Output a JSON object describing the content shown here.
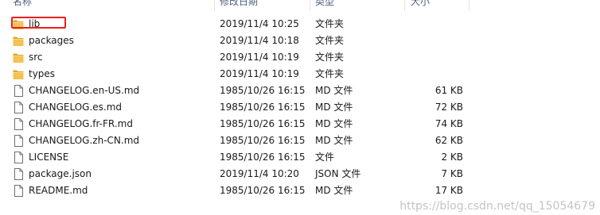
{
  "columns": {
    "name": "名称",
    "date": "修改日期",
    "type": "类型",
    "size": "大小"
  },
  "rows": [
    {
      "name": "lib",
      "date": "2019/11/4 10:25",
      "type": "文件夹",
      "size": "",
      "icon": "folder-icon"
    },
    {
      "name": "packages",
      "date": "2019/11/4 10:18",
      "type": "文件夹",
      "size": "",
      "icon": "folder-icon"
    },
    {
      "name": "src",
      "date": "2019/11/4 10:19",
      "type": "文件夹",
      "size": "",
      "icon": "folder-icon"
    },
    {
      "name": "types",
      "date": "2019/11/4 10:19",
      "type": "文件夹",
      "size": "",
      "icon": "folder-icon"
    },
    {
      "name": "CHANGELOG.en-US.md",
      "date": "1985/10/26 16:15",
      "type": "MD 文件",
      "size": "61 KB",
      "icon": "document-icon"
    },
    {
      "name": "CHANGELOG.es.md",
      "date": "1985/10/26 16:15",
      "type": "MD 文件",
      "size": "72 KB",
      "icon": "document-icon"
    },
    {
      "name": "CHANGELOG.fr-FR.md",
      "date": "1985/10/26 16:15",
      "type": "MD 文件",
      "size": "74 KB",
      "icon": "document-icon"
    },
    {
      "name": "CHANGELOG.zh-CN.md",
      "date": "1985/10/26 16:15",
      "type": "MD 文件",
      "size": "62 KB",
      "icon": "document-icon"
    },
    {
      "name": "LICENSE",
      "date": "1985/10/26 16:15",
      "type": "文件",
      "size": "2 KB",
      "icon": "document-icon"
    },
    {
      "name": "package.json",
      "date": "2019/11/4 10:20",
      "type": "JSON 文件",
      "size": "7 KB",
      "icon": "document-icon"
    },
    {
      "name": "README.md",
      "date": "1985/10/26 16:15",
      "type": "MD 文件",
      "size": "17 KB",
      "icon": "document-icon"
    }
  ],
  "watermark": "https://blog.csdn.net/qq_15054679",
  "colors": {
    "folder": "#f3c24f",
    "highlight": "#e8201f"
  }
}
